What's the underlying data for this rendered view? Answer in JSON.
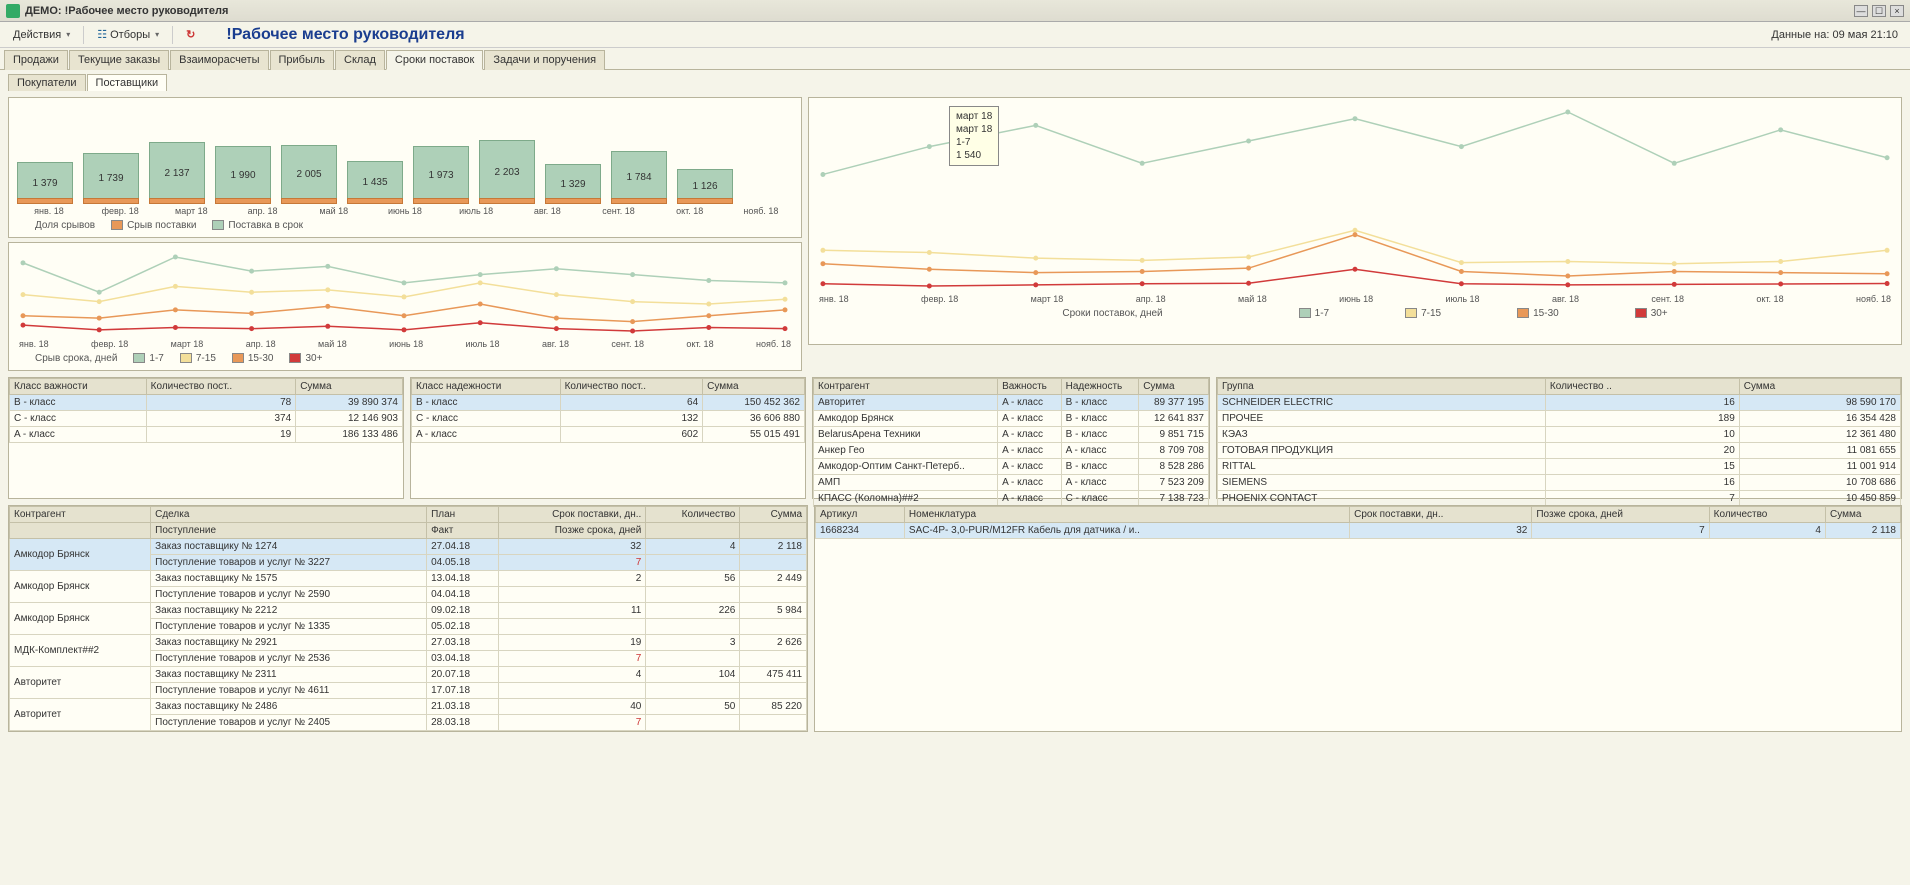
{
  "window": {
    "title": "ДЕМО: !Рабочее место руководителя"
  },
  "toolbar": {
    "actions": "Действия",
    "filters": "Отборы",
    "refresh": "↻",
    "page_title": "!Рабочее место руководителя",
    "status": "Данные на: 09 мая 21:10"
  },
  "main_tabs": [
    "Продажи",
    "Текущие заказы",
    "Взаиморасчеты",
    "Прибыль",
    "Склад",
    "Сроки поставок",
    "Задачи и поручения"
  ],
  "main_tab_active": 5,
  "sub_tabs": [
    "Покупатели",
    "Поставщики"
  ],
  "sub_tab_active": 1,
  "chart_data": [
    {
      "type": "bar",
      "title": "Доля срывов",
      "categories": [
        "янв. 18",
        "февр. 18",
        "март 18",
        "апр. 18",
        "май 18",
        "июнь 18",
        "июль 18",
        "авг. 18",
        "сент. 18",
        "окт. 18",
        "нояб. 18"
      ],
      "series": [
        {
          "name": "Поставка в срок",
          "values": [
            1379,
            1739,
            2137,
            1990,
            2005,
            1435,
            1973,
            2203,
            1329,
            1784,
            1126
          ],
          "color": "#aed0b8"
        },
        {
          "name": "Срыв поставки",
          "values": [
            110,
            90,
            180,
            200,
            120,
            80,
            70,
            60,
            50,
            40,
            35
          ],
          "color": "#e89858"
        }
      ],
      "legend": [
        "Доля срывов",
        "Срыв поставки",
        "Поставка в срок"
      ]
    },
    {
      "type": "line",
      "title": "Срыв срока, дней",
      "categories": [
        "янв. 18",
        "февр. 18",
        "март 18",
        "апр. 18",
        "май 18",
        "июнь 18",
        "июль 18",
        "авг. 18",
        "сент. 18",
        "окт. 18",
        "нояб. 18"
      ],
      "series": [
        {
          "name": "1-7",
          "color": "#aed0b8",
          "values": [
            65,
            40,
            70,
            58,
            62,
            48,
            55,
            60,
            55,
            50,
            48
          ]
        },
        {
          "name": "7-15",
          "color": "#f3df9a",
          "values": [
            38,
            32,
            45,
            40,
            42,
            36,
            48,
            38,
            32,
            30,
            34
          ]
        },
        {
          "name": "15-30",
          "color": "#e89858",
          "values": [
            20,
            18,
            25,
            22,
            28,
            20,
            30,
            18,
            15,
            20,
            25
          ]
        },
        {
          "name": "30+",
          "color": "#d13a3a",
          "values": [
            12,
            8,
            10,
            9,
            11,
            8,
            14,
            9,
            7,
            10,
            9
          ]
        }
      ]
    },
    {
      "type": "line",
      "title": "Сроки поставок, дней",
      "categories": [
        "янв. 18",
        "февр. 18",
        "март 18",
        "апр. 18",
        "май 18",
        "июнь 18",
        "июль 18",
        "авг. 18",
        "сент. 18",
        "окт. 18",
        "нояб. 18"
      ],
      "tooltip": {
        "lines": [
          "март 18",
          "март 18",
          "1-7",
          "1 540"
        ]
      },
      "series": [
        {
          "name": "1-7",
          "color": "#aed0b8",
          "values": [
            1100,
            1350,
            1540,
            1200,
            1400,
            1600,
            1350,
            1660,
            1200,
            1500,
            1250
          ]
        },
        {
          "name": "7-15",
          "color": "#f3df9a",
          "values": [
            420,
            400,
            350,
            330,
            360,
            600,
            310,
            320,
            300,
            320,
            420
          ]
        },
        {
          "name": "15-30",
          "color": "#e89858",
          "values": [
            300,
            250,
            220,
            230,
            260,
            560,
            230,
            190,
            230,
            220,
            210
          ]
        },
        {
          "name": "30+",
          "color": "#d13a3a",
          "values": [
            120,
            100,
            110,
            120,
            125,
            250,
            120,
            110,
            115,
            118,
            122
          ]
        }
      ]
    }
  ],
  "legend2": {
    "title": "Срыв срока, дней",
    "items": [
      {
        "label": "1-7",
        "color": "#aed0b8"
      },
      {
        "label": "7-15",
        "color": "#f3df9a"
      },
      {
        "label": "15-30",
        "color": "#e89858"
      },
      {
        "label": "30+",
        "color": "#d13a3a"
      }
    ]
  },
  "legend3": {
    "title": "Сроки поставок, дней",
    "items": [
      {
        "label": "1-7",
        "color": "#aed0b8"
      },
      {
        "label": "7-15",
        "color": "#f3df9a"
      },
      {
        "label": "15-30",
        "color": "#e89858"
      },
      {
        "label": "30+",
        "color": "#d13a3a"
      }
    ]
  },
  "importance_table": {
    "headers": [
      "Класс важности",
      "Количество пост..",
      "Сумма"
    ],
    "rows": [
      [
        "B - класс",
        "78",
        "39 890 374"
      ],
      [
        "C - класс",
        "374",
        "12 146 903"
      ],
      [
        "A - класс",
        "19",
        "186 133 486"
      ]
    ],
    "selected": 0
  },
  "reliability_table": {
    "headers": [
      "Класс надежности",
      "Количество пост..",
      "Сумма"
    ],
    "rows": [
      [
        "B - класс",
        "64",
        "150 452 362"
      ],
      [
        "C - класс",
        "132",
        "36 606 880"
      ],
      [
        "A - класс",
        "602",
        "55 015 491"
      ]
    ],
    "selected": 0
  },
  "counterparty_table": {
    "headers": [
      "Контрагент",
      "Важность",
      "Надежность",
      "Сумма"
    ],
    "rows": [
      [
        "Авторитет",
        "A - класс",
        "B - класс",
        "89 377 195"
      ],
      [
        "Амкодор Брянск",
        "A - класс",
        "B - класс",
        "12 641 837"
      ],
      [
        "BelarusАрена Техники",
        "A - класс",
        "B - класс",
        "9 851 715"
      ],
      [
        "Анкер Гео",
        "A - класс",
        "A - класс",
        "8 709 708"
      ],
      [
        "Амкодор-Оптим Санкт-Петерб..",
        "A - класс",
        "B - класс",
        "8 528 286"
      ],
      [
        "АМП",
        "A - класс",
        "A - класс",
        "7 523 209"
      ],
      [
        "КПАСС (Коломна)##2",
        "A - класс",
        "C - класс",
        "7 138 723"
      ]
    ],
    "selected": 0
  },
  "group_table": {
    "headers": [
      "Группа",
      "Количество ..",
      "Сумма"
    ],
    "rows": [
      [
        "SCHNEIDER ELECTRIC",
        "16",
        "98 590 170"
      ],
      [
        "ПРОЧЕЕ",
        "189",
        "16 354 428"
      ],
      [
        "КЭАЗ",
        "10",
        "12 361 480"
      ],
      [
        "ГОТОВАЯ ПРОДУКЦИЯ",
        "20",
        "11 081 655"
      ],
      [
        "RITTAL",
        "15",
        "11 001 914"
      ],
      [
        "SIEMENS",
        "16",
        "10 708 686"
      ],
      [
        "PHOENIX CONTACT",
        "7",
        "10 450 859"
      ]
    ],
    "selected": 0
  },
  "deals_table": {
    "headers1": [
      "Контрагент",
      "Сделка",
      "План",
      "Срок поставки, дн..",
      "Количество",
      "Сумма"
    ],
    "headers2": [
      "",
      "Поступление",
      "Факт",
      "Позже срока, дней",
      "",
      ""
    ],
    "rows": [
      {
        "c": "Амкодор Брянск",
        "d1": "Заказ поставщику № 1274",
        "d2": "Поступление товаров и услуг № 3227",
        "pl": "27.04.18",
        "fa": "04.05.18",
        "sr": "32",
        "ps": "7",
        "q": "4",
        "s": "2 118"
      },
      {
        "c": "Амкодор Брянск",
        "d1": "Заказ поставщику № 1575",
        "d2": "Поступление товаров и услуг № 2590",
        "pl": "13.04.18",
        "fa": "04.04.18",
        "sr": "2",
        "ps": "",
        "q": "56",
        "s": "2 449"
      },
      {
        "c": "Амкодор Брянск",
        "d1": "Заказ поставщику № 2212",
        "d2": "Поступление товаров и услуг № 1335",
        "pl": "09.02.18",
        "fa": "05.02.18",
        "sr": "11",
        "ps": "",
        "q": "226",
        "s": "5 984"
      },
      {
        "c": "МДК-Комплект##2",
        "d1": "Заказ поставщику № 2921",
        "d2": "Поступление товаров и услуг № 2536",
        "pl": "27.03.18",
        "fa": "03.04.18",
        "sr": "19",
        "ps": "7",
        "q": "3",
        "s": "2 626"
      },
      {
        "c": "Авторитет",
        "d1": "Заказ поставщику № 2311",
        "d2": "Поступление товаров и услуг № 4611",
        "pl": "20.07.18",
        "fa": "17.07.18",
        "sr": "4",
        "ps": "",
        "q": "104",
        "s": "475 411"
      },
      {
        "c": "Авторитет",
        "d1": "Заказ поставщику № 2486",
        "d2": "Поступление товаров и услуг № 2405",
        "pl": "21.03.18",
        "fa": "28.03.18",
        "sr": "40",
        "ps": "7",
        "q": "50",
        "s": "85 220"
      }
    ]
  },
  "article_table": {
    "headers": [
      "Артикул",
      "Номенклатура",
      "Срок поставки, дн..",
      "Позже срока, дней",
      "Количество",
      "Сумма"
    ],
    "rows": [
      [
        "1668234",
        "SAC-4P- 3,0-PUR/M12FR Кабель для датчика / и..",
        "32",
        "7",
        "4",
        "2 118"
      ]
    ],
    "selected": 0
  }
}
